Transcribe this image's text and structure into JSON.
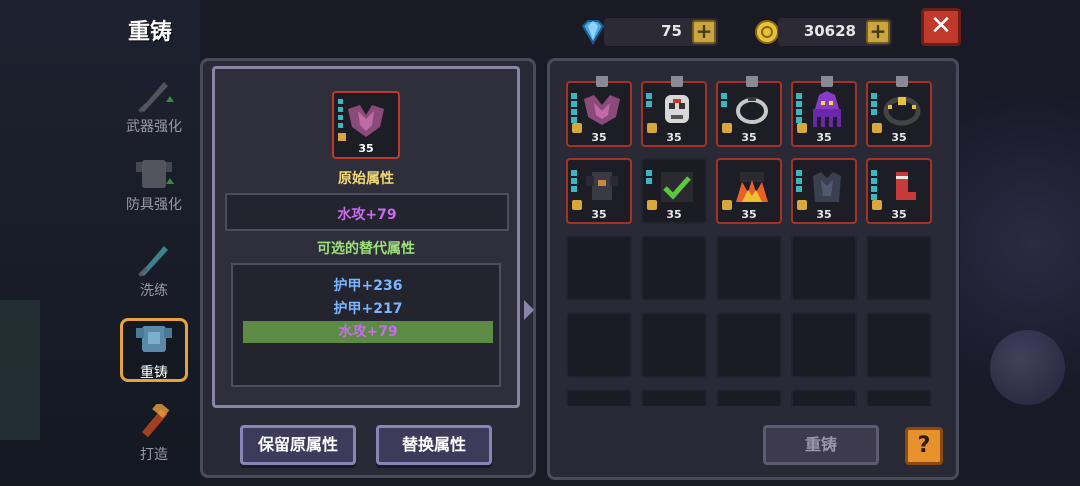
{
  "header": {
    "title": "重铸",
    "gems": "75",
    "gold": "30628",
    "plus": "+",
    "close": "✕"
  },
  "nav": [
    {
      "label": "武器强化",
      "icon": "sword-icon"
    },
    {
      "label": "防具强化",
      "icon": "armor-icon"
    },
    {
      "label": "洗练",
      "icon": "crystal-sword-icon"
    },
    {
      "label": "重铸",
      "icon": "armor-reforge-icon",
      "active": true
    },
    {
      "label": "打造",
      "icon": "hammer-icon"
    }
  ],
  "left": {
    "item_level": "35",
    "original_title": "原始属性",
    "original_value": "水攻+79",
    "alt_title": "可选的替代属性",
    "alternatives": [
      "护甲+236",
      "护甲+217",
      "水攻+79"
    ],
    "keep_button": "保留原属性",
    "replace_button": "替换属性"
  },
  "right": {
    "items": [
      {
        "level": "35",
        "icon": "bat-wing-armor-icon"
      },
      {
        "level": "35",
        "icon": "skull-mask-icon"
      },
      {
        "level": "35",
        "icon": "ring-icon"
      },
      {
        "level": "35",
        "icon": "purple-octopus-icon"
      },
      {
        "level": "35",
        "icon": "dark-crown-icon"
      },
      {
        "level": "35",
        "icon": "dark-knight-armor-icon"
      },
      {
        "level": "35",
        "icon": "green-check-icon"
      },
      {
        "level": "35",
        "icon": "fire-cloak-icon"
      },
      {
        "level": "35",
        "icon": "shadow-armor-icon"
      },
      {
        "level": "35",
        "icon": "red-boot-icon"
      }
    ],
    "reforge_button": "重铸",
    "help_button": "?"
  },
  "colors": {
    "accent_purple": "#c86cf0",
    "alt_blue": "#7ab6ff",
    "section_title_yellow": "#f0d878",
    "section_title_green": "#9ee07a",
    "selected_bg": "#5c8b43"
  }
}
